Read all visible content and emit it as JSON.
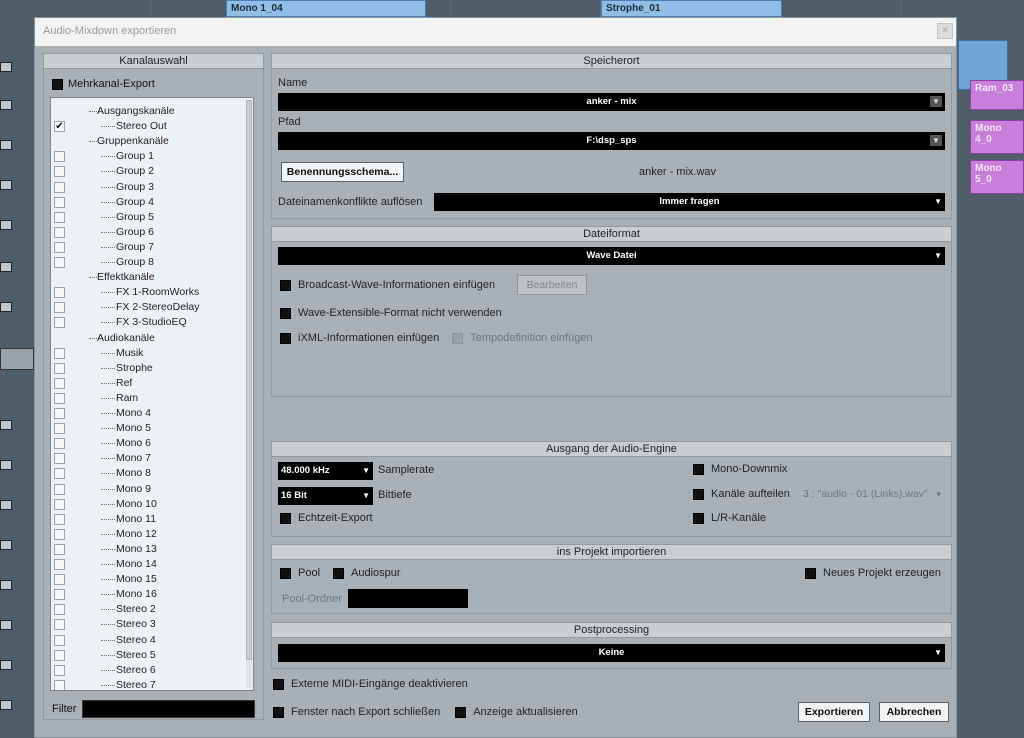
{
  "background": {
    "clips": [
      {
        "label": "Mono 1_04"
      },
      {
        "label": "Strophe_01"
      },
      {
        "label": "Ram_03"
      },
      {
        "label": "Mono 4_0"
      },
      {
        "label": "Mono 5_0"
      }
    ]
  },
  "dialog": {
    "title": "Audio-Mixdown exportieren",
    "close": "×"
  },
  "channel_selection": {
    "header": "Kanalauswahl",
    "multichannel_label": "Mehrkanal-Export",
    "filter_label": "Filter",
    "tree": [
      {
        "label": "Ausgangskanäle",
        "level": 0,
        "checkbox": false
      },
      {
        "label": "Stereo Out",
        "level": 1,
        "checkbox": true,
        "checked": true,
        "checkmark": "✔"
      },
      {
        "label": "Gruppenkanäle",
        "level": 0,
        "checkbox": false
      },
      {
        "label": "Group 1",
        "level": 1,
        "checkbox": true
      },
      {
        "label": "Group 2",
        "level": 1,
        "checkbox": true
      },
      {
        "label": "Group 3",
        "level": 1,
        "checkbox": true
      },
      {
        "label": "Group 4",
        "level": 1,
        "checkbox": true
      },
      {
        "label": "Group 5",
        "level": 1,
        "checkbox": true
      },
      {
        "label": "Group 6",
        "level": 1,
        "checkbox": true
      },
      {
        "label": "Group 7",
        "level": 1,
        "checkbox": true
      },
      {
        "label": "Group 8",
        "level": 1,
        "checkbox": true
      },
      {
        "label": "Effektkanäle",
        "level": 0,
        "checkbox": false
      },
      {
        "label": "FX 1-RoomWorks",
        "level": 1,
        "checkbox": true
      },
      {
        "label": "FX 2-StereoDelay",
        "level": 1,
        "checkbox": true
      },
      {
        "label": "FX 3-StudioEQ",
        "level": 1,
        "checkbox": true
      },
      {
        "label": "Audiokanäle",
        "level": 0,
        "checkbox": false
      },
      {
        "label": "Musik",
        "level": 1,
        "checkbox": true
      },
      {
        "label": "Strophe",
        "level": 1,
        "checkbox": true
      },
      {
        "label": "Ref",
        "level": 1,
        "checkbox": true
      },
      {
        "label": "Ram",
        "level": 1,
        "checkbox": true
      },
      {
        "label": "Mono 4",
        "level": 1,
        "checkbox": true
      },
      {
        "label": "Mono 5",
        "level": 1,
        "checkbox": true
      },
      {
        "label": "Mono 6",
        "level": 1,
        "checkbox": true
      },
      {
        "label": "Mono 7",
        "level": 1,
        "checkbox": true
      },
      {
        "label": "Mono 8",
        "level": 1,
        "checkbox": true
      },
      {
        "label": "Mono 9",
        "level": 1,
        "checkbox": true
      },
      {
        "label": "Mono 10",
        "level": 1,
        "checkbox": true
      },
      {
        "label": "Mono 11",
        "level": 1,
        "checkbox": true
      },
      {
        "label": "Mono 12",
        "level": 1,
        "checkbox": true
      },
      {
        "label": "Mono 13",
        "level": 1,
        "checkbox": true
      },
      {
        "label": "Mono 14",
        "level": 1,
        "checkbox": true
      },
      {
        "label": "Mono 15",
        "level": 1,
        "checkbox": true
      },
      {
        "label": "Mono 16",
        "level": 1,
        "checkbox": true
      },
      {
        "label": "Stereo 2",
        "level": 1,
        "checkbox": true
      },
      {
        "label": "Stereo 3",
        "level": 1,
        "checkbox": true
      },
      {
        "label": "Stereo 4",
        "level": 1,
        "checkbox": true
      },
      {
        "label": "Stereo 5",
        "level": 1,
        "checkbox": true
      },
      {
        "label": "Stereo 6",
        "level": 1,
        "checkbox": true
      },
      {
        "label": "Stereo 7",
        "level": 1,
        "checkbox": true
      }
    ]
  },
  "location": {
    "header": "Speicherort",
    "name_label": "Name",
    "name_value": "anker - mix",
    "path_label": "Pfad",
    "path_value": "F:\\dsp_sps",
    "naming_button": "Benennungsschema...",
    "filename_preview": "anker - mix.wav",
    "conflict_label": "Dateinamenkonflikte auflösen",
    "conflict_value": "Immer fragen"
  },
  "file_format": {
    "header": "Dateiformat",
    "format_value": "Wave Datei",
    "bwf_label": "Broadcast-Wave-Informationen einfügen",
    "edit_button": "Bearbeiten",
    "wave_ext_label": "Wave-Extensible-Format nicht verwenden",
    "ixml_label": "iXML-Informationen einfügen",
    "tempo_label": "Tempodefinition einfügen"
  },
  "engine_output": {
    "header": "Ausgang der Audio-Engine",
    "samplerate_value": "48.000 kHz",
    "samplerate_label": "Samplerate",
    "bitdepth_value": "16 Bit",
    "bitdepth_label": "Bittiefe",
    "realtime_label": "Echtzeit-Export",
    "mono_downmix_label": "Mono-Downmix",
    "split_channels_label": "Kanäle aufteilen",
    "split_channels_value": "3 : \"audio - 01 (Links).wav\"",
    "lr_channels_label": "L/R-Kanäle"
  },
  "import_project": {
    "header": "ins Projekt importieren",
    "pool_label": "Pool",
    "audio_track_label": "Audiospur",
    "new_project_label": "Neues Projekt erzeugen",
    "pool_folder_label": "Pool-Ordner"
  },
  "postprocessing": {
    "header": "Postprocessing",
    "value": "Keine"
  },
  "footer": {
    "midi_label": "Externe MIDI-Eingänge deaktivieren",
    "close_after_label": "Fenster nach Export schließen",
    "update_display_label": "Anzeige aktualisieren",
    "export_button": "Exportieren",
    "cancel_button": "Abbrechen"
  },
  "colors": {
    "dialog_bg": "#a9b1b7",
    "field_bg": "#000000",
    "clip_blue": "#8fbfe7",
    "clip_purple": "#c77fd9"
  }
}
